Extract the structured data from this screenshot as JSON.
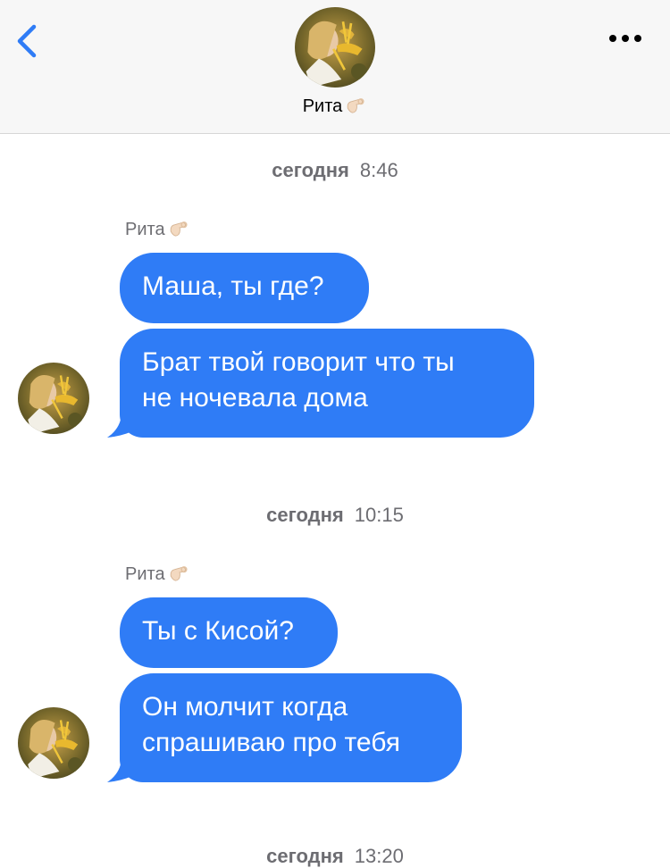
{
  "header": {
    "contact_name": "Рита",
    "name_emoji": "ok-hand-emoji",
    "back_icon": "chevron-left-icon",
    "more_icon": "more-dots-icon",
    "accent": "#2f7cf6"
  },
  "messages": [
    {
      "timestamp_day": "сегодня",
      "timestamp_time": "8:46",
      "sender": "Рита",
      "bubbles": [
        "Маша, ты где?",
        "Брат твой говорит что ты",
        "не ночевала дома"
      ]
    },
    {
      "timestamp_day": "сегодня",
      "timestamp_time": "10:15",
      "sender": "Рита",
      "bubbles": [
        "Ты с Кисой?",
        "Он молчит когда",
        "спрашиваю про тебя"
      ]
    },
    {
      "timestamp_day": "сегодня",
      "timestamp_time": "13:20"
    }
  ],
  "colors": {
    "bubble": "#2f7cf6",
    "timestamp": "#6d6d72",
    "header_bg": "#f7f7f7"
  }
}
